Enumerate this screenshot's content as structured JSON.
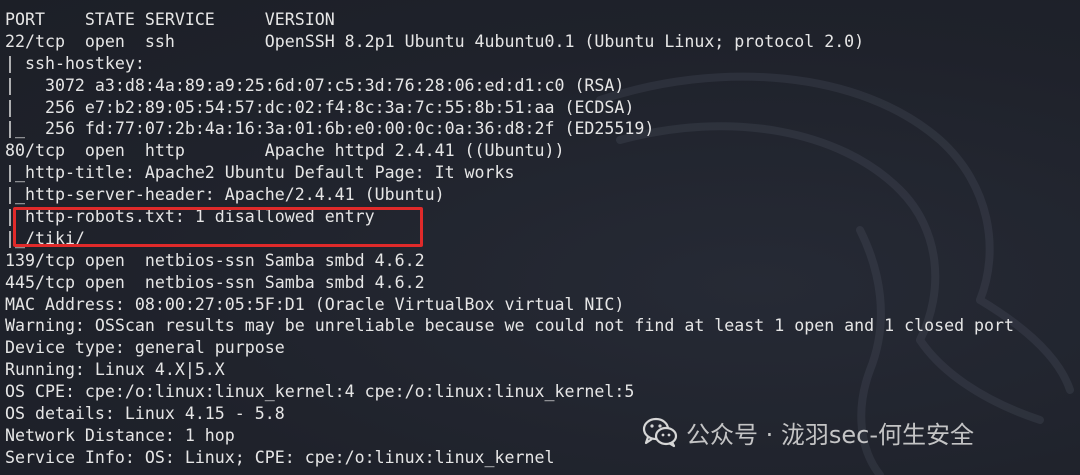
{
  "terminal": {
    "lines": [
      "PORT    STATE SERVICE     VERSION",
      "22/tcp  open  ssh         OpenSSH 8.2p1 Ubuntu 4ubuntu0.1 (Ubuntu Linux; protocol 2.0)",
      "| ssh-hostkey:",
      "|   3072 a3:d8:4a:89:a9:25:6d:07:c5:3d:76:28:06:ed:d1:c0 (RSA)",
      "|   256 e7:b2:89:05:54:57:dc:02:f4:8c:3a:7c:55:8b:51:aa (ECDSA)",
      "|_  256 fd:77:07:2b:4a:16:3a:01:6b:e0:00:0c:0a:36:d8:2f (ED25519)",
      "80/tcp  open  http        Apache httpd 2.4.41 ((Ubuntu))",
      "|_http-title: Apache2 Ubuntu Default Page: It works",
      "|_http-server-header: Apache/2.4.41 (Ubuntu)",
      "| http-robots.txt: 1 disallowed entry",
      "|_/tiki/",
      "139/tcp open  netbios-ssn Samba smbd 4.6.2",
      "445/tcp open  netbios-ssn Samba smbd 4.6.2",
      "MAC Address: 08:00:27:05:5F:D1 (Oracle VirtualBox virtual NIC)",
      "Warning: OSScan results may be unreliable because we could not find at least 1 open and 1 closed port",
      "Device type: general purpose",
      "Running: Linux 4.X|5.X",
      "OS CPE: cpe:/o:linux:linux_kernel:4 cpe:/o:linux:linux_kernel:5",
      "OS details: Linux 4.15 - 5.8",
      "Network Distance: 1 hop",
      "Service Info: OS: Linux; CPE: cpe:/o:linux:linux_kernel"
    ],
    "background_color": "#20232d",
    "text_color": "#e6e6e6",
    "highlight_color": "#e02a2a"
  },
  "watermark": {
    "text": "公众号 · 泷羽sec-何生安全",
    "icon": "wechat-icon"
  }
}
